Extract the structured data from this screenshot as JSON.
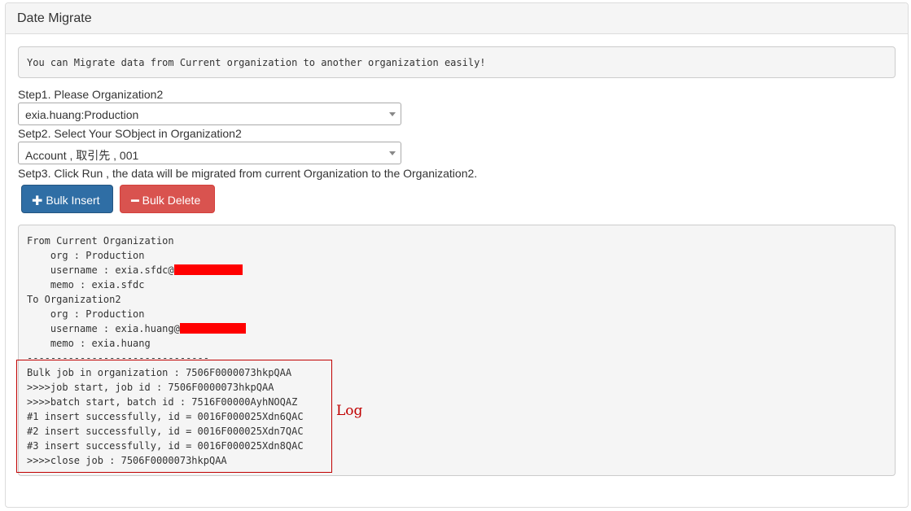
{
  "panel": {
    "title": "Date Migrate"
  },
  "info_text": "You can Migrate data from Current organization to another organization easily!",
  "step1": {
    "label": "Step1. Please Organization2",
    "selected": "exia.huang:Production"
  },
  "step2": {
    "label": "Setp2. Select Your SObject in Organization2",
    "selected": "Account , 取引先 , 001"
  },
  "step3": {
    "label": "Setp3. Click Run , the data will be migrated from current Organization to the Organization2."
  },
  "buttons": {
    "bulk_insert": "Bulk Insert",
    "bulk_delete": "Bulk Delete",
    "insert_icon": "plus-icon",
    "delete_icon": "minus-icon"
  },
  "output": {
    "from_header": "From Current Organization",
    "from_org": "    org : Production",
    "from_username": "    username : exia.sfdc@",
    "from_memo": "    memo : exia.sfdc",
    "to_header": "To Organization2",
    "to_org": "    org : Production",
    "to_username": "    username : exia.huang@",
    "to_memo": "    memo : exia.huang",
    "separator": "-------------------------------",
    "log_lines": [
      "Bulk job in organization : 7506F0000073hkpQAA",
      ">>>>job start, job id : 7506F0000073hkpQAA",
      ">>>>batch start, batch id : 7516F00000AyhNOQAZ",
      "#1 insert successfully, id = 0016F000025Xdn6QAC",
      "#2 insert successfully, id = 0016F000025Xdn7QAC",
      "#3 insert successfully, id = 0016F000025Xdn8QAC",
      ">>>>close job : 7506F0000073hkpQAA"
    ]
  },
  "annotation": {
    "log_label": "Log"
  },
  "colors": {
    "primary": "#2f6ea5",
    "danger": "#d9534f",
    "annotation": "#c00000",
    "redaction": "#ff0000"
  }
}
